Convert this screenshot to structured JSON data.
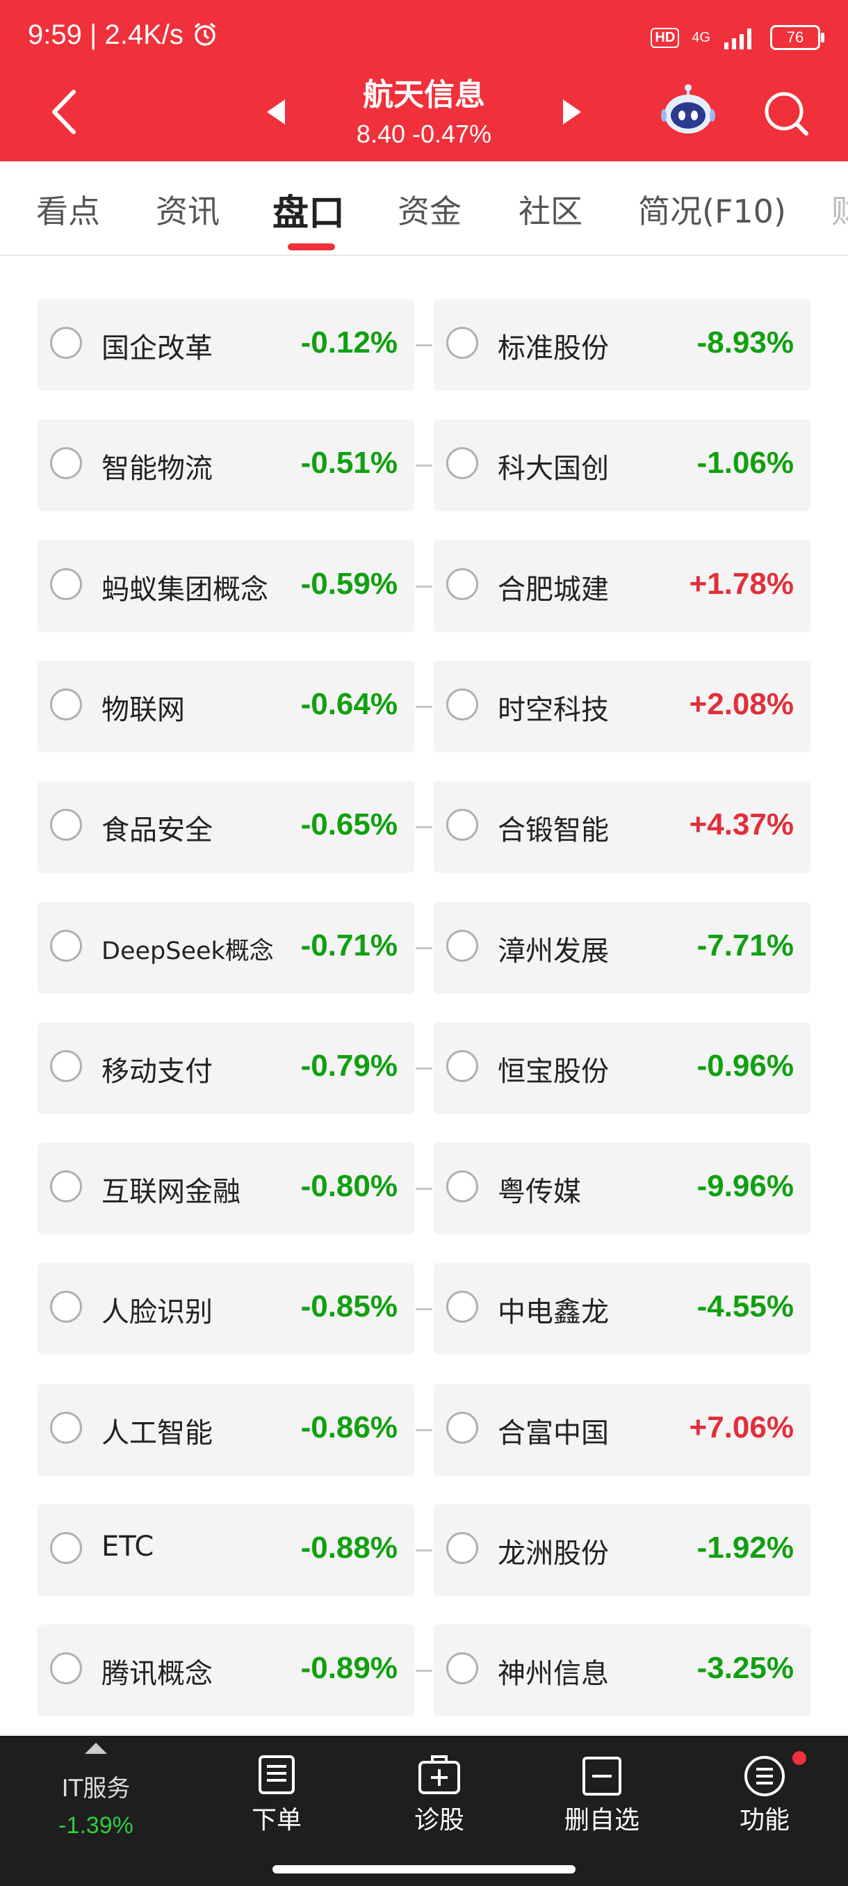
{
  "status_bar": {
    "time": "9:59 | 2.4K/s",
    "alarm_icon": "alarm-icon",
    "hd": "HD",
    "network": "4G",
    "battery": "76"
  },
  "header": {
    "title": "航天信息",
    "price_change": "8.40  -0.47%"
  },
  "tabs": [
    {
      "label": "看点"
    },
    {
      "label": "资讯"
    },
    {
      "label": "盘口"
    },
    {
      "label": "资金"
    },
    {
      "label": "社区"
    },
    {
      "label": "简况(F10)"
    },
    {
      "label": "财"
    }
  ],
  "active_tab_index": 2,
  "rows": [
    {
      "left": {
        "name": "国企改革",
        "pct": "-0.12%",
        "dir": "down"
      },
      "right": {
        "name": "标准股份",
        "pct": "-8.93%",
        "dir": "down"
      }
    },
    {
      "left": {
        "name": "智能物流",
        "pct": "-0.51%",
        "dir": "down"
      },
      "right": {
        "name": "科大国创",
        "pct": "-1.06%",
        "dir": "down"
      }
    },
    {
      "left": {
        "name": "蚂蚁集团概念",
        "pct": "-0.59%",
        "dir": "down"
      },
      "right": {
        "name": "合肥城建",
        "pct": "+1.78%",
        "dir": "up"
      }
    },
    {
      "left": {
        "name": "物联网",
        "pct": "-0.64%",
        "dir": "down"
      },
      "right": {
        "name": "时空科技",
        "pct": "+2.08%",
        "dir": "up"
      }
    },
    {
      "left": {
        "name": "食品安全",
        "pct": "-0.65%",
        "dir": "down"
      },
      "right": {
        "name": "合锻智能",
        "pct": "+4.37%",
        "dir": "up"
      }
    },
    {
      "left": {
        "name": "DeepSeek概念",
        "pct": "-0.71%",
        "dir": "down"
      },
      "right": {
        "name": "漳州发展",
        "pct": "-7.71%",
        "dir": "down"
      }
    },
    {
      "left": {
        "name": "移动支付",
        "pct": "-0.79%",
        "dir": "down"
      },
      "right": {
        "name": "恒宝股份",
        "pct": "-0.96%",
        "dir": "down"
      }
    },
    {
      "left": {
        "name": "互联网金融",
        "pct": "-0.80%",
        "dir": "down"
      },
      "right": {
        "name": "粤传媒",
        "pct": "-9.96%",
        "dir": "down"
      }
    },
    {
      "left": {
        "name": "人脸识别",
        "pct": "-0.85%",
        "dir": "down"
      },
      "right": {
        "name": "中电鑫龙",
        "pct": "-4.55%",
        "dir": "down"
      }
    },
    {
      "left": {
        "name": "人工智能",
        "pct": "-0.86%",
        "dir": "down"
      },
      "right": {
        "name": "合富中国",
        "pct": "+7.06%",
        "dir": "up"
      }
    },
    {
      "left": {
        "name": "ETC",
        "pct": "-0.88%",
        "dir": "down"
      },
      "right": {
        "name": "龙洲股份",
        "pct": "-1.92%",
        "dir": "down"
      }
    },
    {
      "left": {
        "name": "腾讯概念",
        "pct": "-0.89%",
        "dir": "down"
      },
      "right": {
        "name": "神州信息",
        "pct": "-3.25%",
        "dir": "down"
      }
    }
  ],
  "bottom_nav": {
    "sector_name": "IT服务",
    "sector_pct": "-1.39%",
    "items": [
      {
        "label": "下单",
        "icon": "order-icon"
      },
      {
        "label": "诊股",
        "icon": "diagnose-icon"
      },
      {
        "label": "删自选",
        "icon": "remove-watchlist-icon"
      },
      {
        "label": "功能",
        "icon": "function-menu-icon"
      }
    ]
  },
  "colors": {
    "brand_red": "#f0303a",
    "down_green": "#10a010",
    "up_red": "#e0303a"
  }
}
